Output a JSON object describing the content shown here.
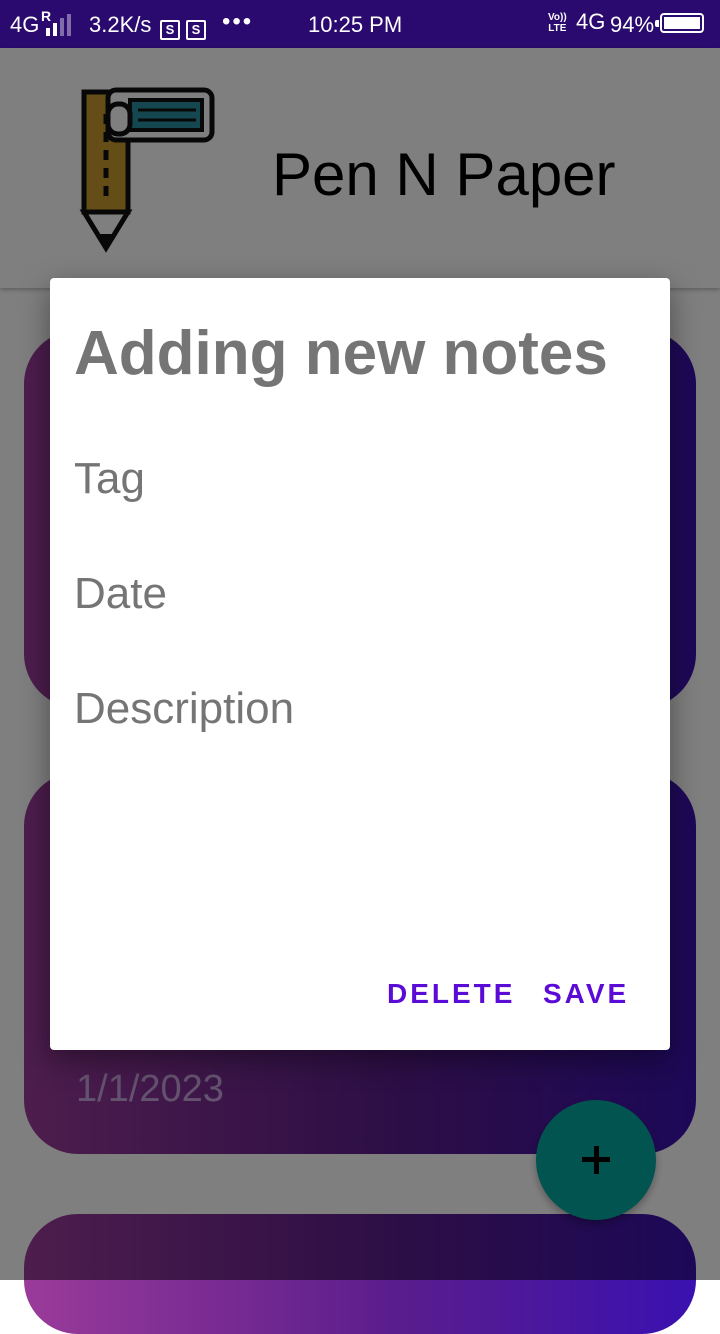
{
  "status_bar": {
    "network": "4G",
    "roaming": "R",
    "speed": "3.2K/s",
    "app_icon": "S",
    "more": "•••",
    "time": "10:25 PM",
    "volte_top": "Vo))",
    "volte_bottom": "LTE",
    "network_right": "4G",
    "battery": "94%"
  },
  "app": {
    "title": "Pen N Paper",
    "logo_icon": "pen-paper-logo-icon"
  },
  "background_card": {
    "date": "1/1/2023"
  },
  "fab": {
    "icon": "plus-icon"
  },
  "dialog": {
    "title": "Adding new notes",
    "fields": {
      "tag_placeholder": "Tag",
      "date_placeholder": "Date",
      "description_placeholder": "Description"
    },
    "buttons": {
      "delete": "DELETE",
      "save": "SAVE"
    }
  },
  "colors": {
    "status_bar": "#2a0a6e",
    "accent": "#5b0bd6",
    "fab": "#03a89e",
    "card_gradient_start": "#9a3b9a",
    "card_gradient_end": "#3a11b0"
  }
}
